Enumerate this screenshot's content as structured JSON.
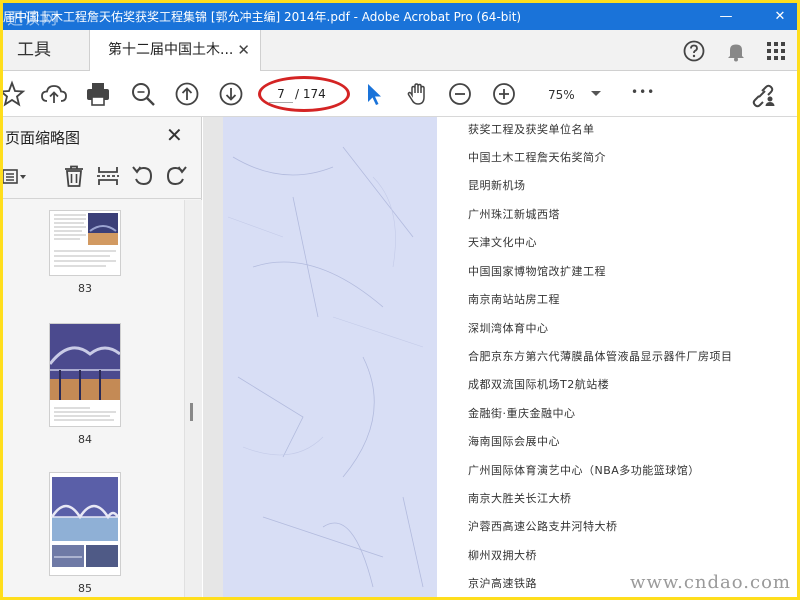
{
  "window": {
    "title": "届中国土木工程詹天佑奖获奖工程集锦 [郭允冲主编] 2014年.pdf - Adobe Acrobat Pro (64-bit)",
    "watermark_left": "迅读网",
    "minimize": "—",
    "maximize": "☐",
    "close": "✕"
  },
  "tabs": {
    "tools_label": "工具",
    "doc_label": "第十二届中国土木...",
    "doc_close": "✕"
  },
  "toolbar": {
    "page_current": "7",
    "page_total": "/ 174",
    "zoom": "75%",
    "more": "•••"
  },
  "sidepanel": {
    "title": "页面缩略图",
    "close": "✕",
    "thumbnails": [
      {
        "label": "83"
      },
      {
        "label": "84"
      },
      {
        "label": "85"
      }
    ]
  },
  "document": {
    "lines": [
      "获奖工程及获奖单位名单",
      "中国土木工程詹天佑奖简介",
      "昆明新机场",
      "广州珠江新城西塔",
      "天津文化中心",
      "中国国家博物馆改扩建工程",
      "南京南站站房工程",
      "深圳湾体育中心",
      "合肥京东方第六代薄膜晶体管液晶显示器件厂房项目",
      "成都双流国际机场T2航站楼",
      "金融街·重庆金融中心",
      "海南国际会展中心",
      "广州国际体育演艺中心（NBA多功能篮球馆）",
      "南京大胜关长江大桥",
      "沪蓉西高速公路支井河特大桥",
      "柳州双拥大桥",
      "京沪高速铁路"
    ],
    "watermark_right": "www.cndao.com"
  },
  "colors": {
    "titlebar": "#1a73d9",
    "accent": "#1a73d9",
    "annotation": "#d42424",
    "border": "#ffde1c"
  }
}
